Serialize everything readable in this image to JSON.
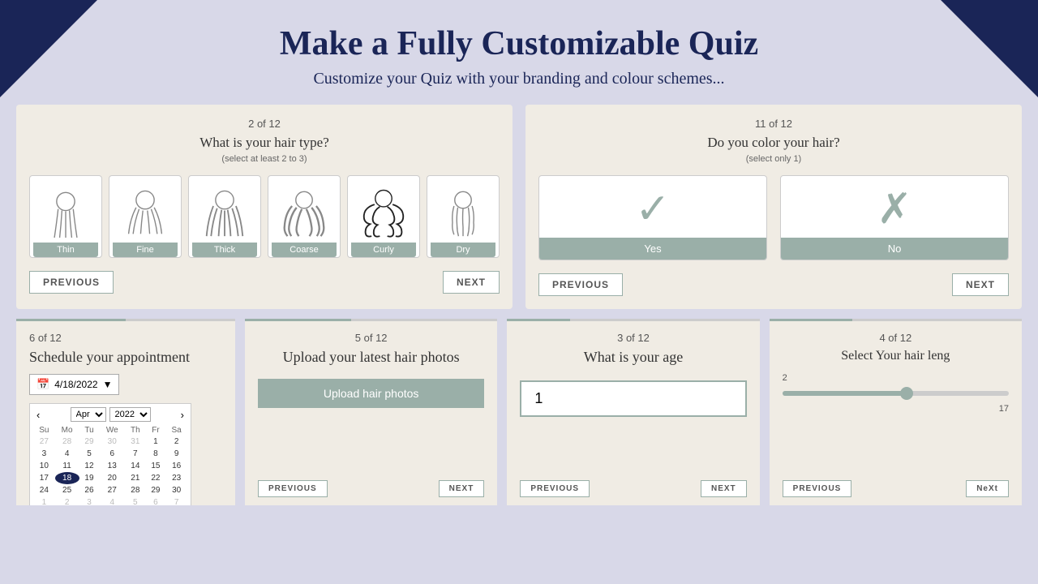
{
  "header": {
    "title": "Make a Fully Customizable Quiz",
    "subtitle": "Customize your Quiz with your branding and colour schemes..."
  },
  "quiz1": {
    "progress": "2 of 12",
    "question": "What is your hair type?",
    "hint": "(select at least 2 to 3)",
    "options": [
      "Thin",
      "Fine",
      "Thick",
      "Coarse",
      "Curly",
      "Dry"
    ],
    "prev_label": "PREVIOUS",
    "next_label": "NEXT"
  },
  "quiz2": {
    "progress": "11 of 12",
    "question": "Do you color your hair?",
    "hint": "(select only 1)",
    "yes_label": "Yes",
    "no_label": "No",
    "prev_label": "PREVIOUS",
    "next_label": "NEXT"
  },
  "quiz3": {
    "progress": "6 of 12",
    "question": "Schedule your appointment",
    "date_value": "4/18/2022"
  },
  "quiz4": {
    "progress": "5 of 12",
    "question": "Upload your latest hair photos",
    "upload_label": "Upload hair photos",
    "prev_label": "PREVIOUS",
    "next_label": "NEXT"
  },
  "quiz5": {
    "progress": "3 of 12",
    "question": "What is your age",
    "input_value": "1",
    "prev_label": "PREVIOUS",
    "next_label": "NEXT"
  },
  "quiz6": {
    "progress": "4 of 12",
    "question": "Select Your hair leng",
    "slider_min": "2",
    "slider_max": "17",
    "prev_label": "PREVIOUS",
    "next_button": "NeXt"
  },
  "calendar": {
    "month": "Apr",
    "year": "2022",
    "days_header": [
      "Su",
      "Mo",
      "Tu",
      "We",
      "Th",
      "Fr",
      "Sa"
    ],
    "weeks": [
      [
        "27",
        "28",
        "29",
        "30",
        "31",
        "1",
        "2"
      ],
      [
        "3",
        "4",
        "5",
        "6",
        "7",
        "8",
        "9"
      ],
      [
        "10",
        "11",
        "12",
        "13",
        "14",
        "15",
        "16"
      ],
      [
        "17",
        "18",
        "19",
        "20",
        "21",
        "22",
        "23"
      ],
      [
        "24",
        "25",
        "26",
        "27",
        "28",
        "29",
        "30"
      ],
      [
        "1",
        "2",
        "3",
        "4",
        "5",
        "6",
        "7"
      ]
    ],
    "today_row": 3,
    "today_col": 1
  }
}
